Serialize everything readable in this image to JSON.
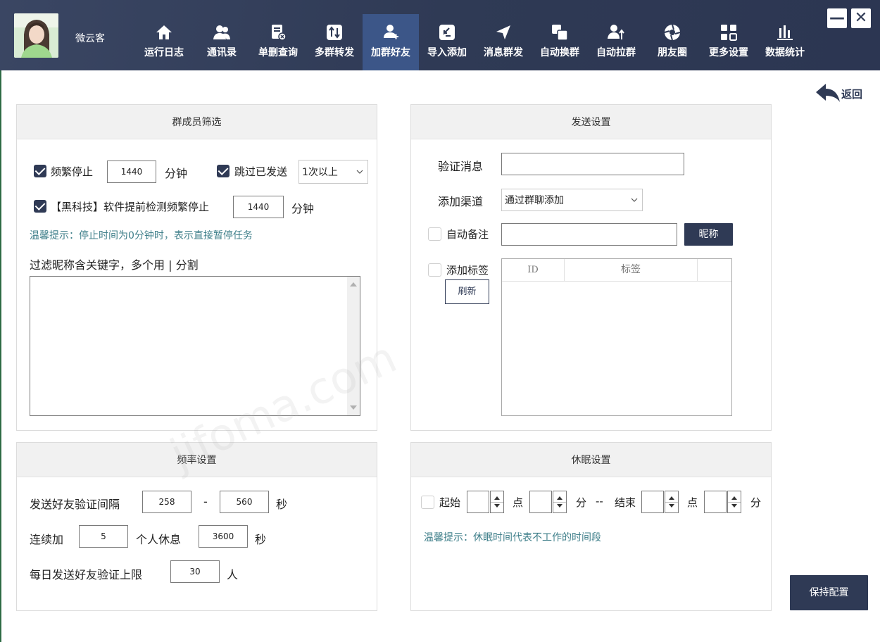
{
  "user": {
    "name": "微云客"
  },
  "nav": [
    {
      "label": "运行日志",
      "icon": "home-icon"
    },
    {
      "label": "通讯录",
      "icon": "contacts-icon"
    },
    {
      "label": "单删查询",
      "icon": "delete-check-icon"
    },
    {
      "label": "多群转发",
      "icon": "forward-icon"
    },
    {
      "label": "加群好友",
      "icon": "add-friend-icon",
      "active": true
    },
    {
      "label": "导入添加",
      "icon": "import-icon"
    },
    {
      "label": "消息群发",
      "icon": "send-icon"
    },
    {
      "label": "自动换群",
      "icon": "switch-group-icon"
    },
    {
      "label": "自动拉群",
      "icon": "pull-group-icon"
    },
    {
      "label": "朋友圈",
      "icon": "moments-icon"
    },
    {
      "label": "更多设置",
      "icon": "grid-icon"
    },
    {
      "label": "数据统计",
      "icon": "bar-chart-icon"
    }
  ],
  "window": {
    "minimize": "—",
    "close": "✕"
  },
  "back_label": "返回",
  "filter": {
    "title": "群成员筛选",
    "freq_stop_label": "频繁停止",
    "freq_stop_checked": true,
    "freq_stop_value": "1440",
    "minutes_unit": "分钟",
    "skip_sent_label": "跳过已发送",
    "skip_sent_checked": true,
    "skip_sent_option": "1次以上",
    "tech_label": "【黑科技】软件提前检测频繁停止",
    "tech_checked": true,
    "tech_value": "1440",
    "tip": "温馨提示：停止时间为0分钟时，表示直接暂停任务",
    "keyword_label": "过滤昵称含关键字，多个用 | 分割",
    "keyword_value": ""
  },
  "send": {
    "title": "发送设置",
    "verify_label": "验证消息",
    "verify_value": "",
    "channel_label": "添加渠道",
    "channel_value": "通过群聊添加",
    "auto_remark_label": "自动备注",
    "auto_remark_checked": false,
    "auto_remark_value": "",
    "nickname_btn": "昵称",
    "tag_label": "添加标签",
    "tag_checked": false,
    "refresh_btn": "刷新",
    "table_headers": [
      "ID",
      "标签"
    ]
  },
  "rate": {
    "title": "频率设置",
    "interval_label": "发送好友验证间隔",
    "interval_min": "258",
    "dash": "-",
    "interval_max": "560",
    "sec_unit": "秒",
    "continuous_label": "连续加",
    "continuous_value": "5",
    "rest_label": "个人休息",
    "rest_value": "3600",
    "daily_label": "每日发送好友验证上限",
    "daily_value": "30",
    "person_unit": "人"
  },
  "sleep": {
    "title": "休眠设置",
    "start_label": "起始",
    "enabled": false,
    "hour_unit": "点",
    "min_unit": "分",
    "sep": "--",
    "end_label": "结束",
    "tip": "温馨提示：休眠时间代表不工作的时间段"
  },
  "save_btn": "保持配置",
  "watermark": "jifoma.com"
}
